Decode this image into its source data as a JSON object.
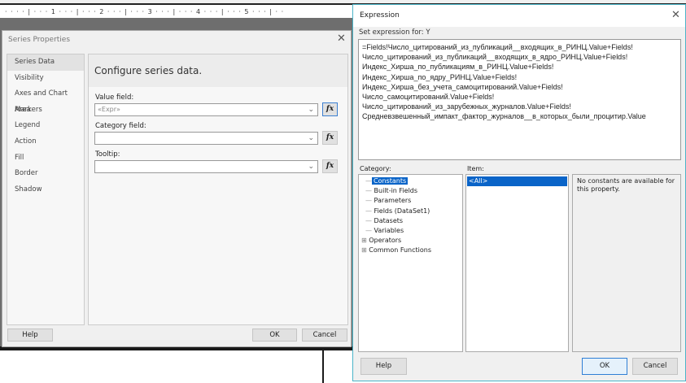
{
  "background": {
    "ruler_marks": [
      "1",
      "2",
      "3",
      "4",
      "5"
    ]
  },
  "series_properties": {
    "title": "Series Properties",
    "nav": [
      "Series Data",
      "Visibility",
      "Axes and Chart Area",
      "Markers",
      "Legend",
      "Action",
      "Fill",
      "Border",
      "Shadow"
    ],
    "heading": "Configure series data.",
    "value_label": "Value field:",
    "value_value": "«Expr»",
    "category_label": "Category field:",
    "category_value": "",
    "tooltip_label": "Tooltip:",
    "tooltip_value": "",
    "fx": "fx",
    "help": "Help",
    "ok": "OK",
    "cancel": "Cancel"
  },
  "expression": {
    "title": "Expression",
    "set_for": "Set expression for: Y",
    "lines": [
      "=Fields!Число_цитирований_из_публикаций__входящих_в_РИНЦ.Value+Fields!",
      "Число_цитирований_из_публикаций__входящих_в_ядро_РИНЦ.Value+Fields!",
      "Индекс_Хирша_по_публикациям_в_РИНЦ.Value+Fields!",
      "Индекс_Хирша_по_ядру_РИНЦ.Value+Fields!",
      "Индекс_Хирша_без_учета_самоцитирований.Value+Fields!",
      "Число_самоцитирований.Value+Fields!",
      "Число_цитирований_из_зарубежных_журналов.Value+Fields!",
      "Средневзвешенный_импакт_фактор_журналов__в_которых_были_процитир.Value"
    ],
    "category_label": "Category:",
    "categories": [
      "Constants",
      "Built-in Fields",
      "Parameters",
      "Fields (DataSet1)",
      "Datasets",
      "Variables",
      "Operators",
      "Common Functions"
    ],
    "item_label": "Item:",
    "items": [
      "<All>"
    ],
    "info": "No constants are available for this property.",
    "help": "Help",
    "ok": "OK",
    "cancel": "Cancel"
  }
}
